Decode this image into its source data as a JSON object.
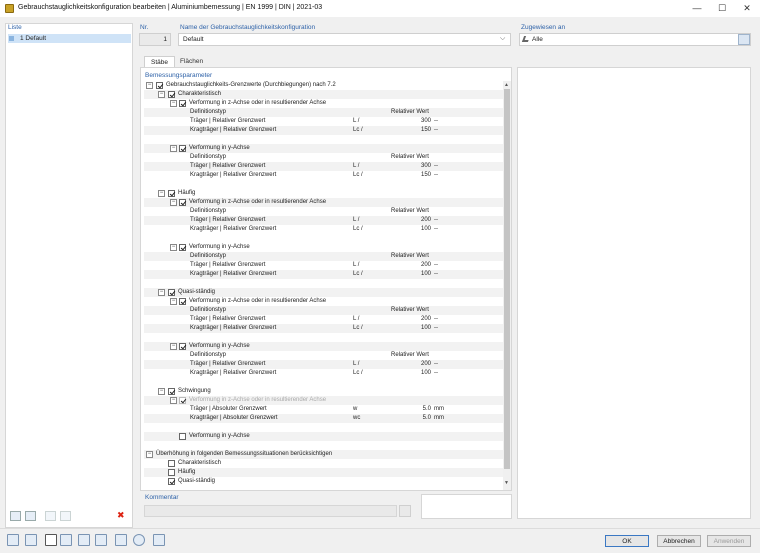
{
  "window": {
    "title": "Gebrauchstauglichkeitskonfiguration bearbeiten | Aluminiumbemessung | EN 1999 | DIN | 2021-03",
    "minimize": "—",
    "maximize": "☐",
    "close": "✕"
  },
  "left": {
    "header": "Liste",
    "item_label": "1  Default",
    "delete_icon": "✖"
  },
  "nr": {
    "header": "Nr.",
    "value": "1"
  },
  "name": {
    "header": "Name der Gebrauchstauglichkeitskonfiguration",
    "value": "Default",
    "chevron": "⌵"
  },
  "assigned": {
    "header": "Zugewiesen an",
    "value": "Alle"
  },
  "tabs": [
    {
      "label": "Stäbe"
    },
    {
      "label": "Flächen"
    }
  ],
  "params_header": "Bemessungsparameter",
  "tree": {
    "root": "Gebrauchstauglichkeits-Grenzwerte (Durchbiegungen) nach 7.2",
    "groups": [
      {
        "label": "Charakteristisch",
        "subs": [
          {
            "label": "Verformung in z-Achse oder in resultierender Achse",
            "deftype": "Definitionstyp",
            "deftype_value": "Relativer Wert",
            "r1": "Träger | Relativer Grenzwert",
            "r1_sym": "L /",
            "r1_val": "300",
            "r1_unit": "--",
            "r2": "Kragträger | Relativer Grenzwert",
            "r2_sym": "Lc /",
            "r2_val": "150",
            "r2_unit": "--"
          },
          {
            "label": "Verformung in y-Achse",
            "deftype": "Definitionstyp",
            "deftype_value": "Relativer Wert",
            "r1": "Träger | Relativer Grenzwert",
            "r1_sym": "L /",
            "r1_val": "300",
            "r1_unit": "--",
            "r2": "Kragträger | Relativer Grenzwert",
            "r2_sym": "Lc /",
            "r2_val": "150",
            "r2_unit": "--"
          }
        ]
      },
      {
        "label": "Häufig",
        "subs": [
          {
            "label": "Verformung in z-Achse oder in resultierender Achse",
            "deftype": "Definitionstyp",
            "deftype_value": "Relativer Wert",
            "r1": "Träger | Relativer Grenzwert",
            "r1_sym": "L /",
            "r1_val": "200",
            "r1_unit": "--",
            "r2": "Kragträger | Relativer Grenzwert",
            "r2_sym": "Lc /",
            "r2_val": "100",
            "r2_unit": "--"
          },
          {
            "label": "Verformung in y-Achse",
            "deftype": "Definitionstyp",
            "deftype_value": "Relativer Wert",
            "r1": "Träger | Relativer Grenzwert",
            "r1_sym": "L /",
            "r1_val": "200",
            "r1_unit": "--",
            "r2": "Kragträger | Relativer Grenzwert",
            "r2_sym": "Lc /",
            "r2_val": "100",
            "r2_unit": "--"
          }
        ]
      },
      {
        "label": "Quasi-ständig",
        "subs": [
          {
            "label": "Verformung in z-Achse oder in resultierender Achse",
            "deftype": "Definitionstyp",
            "deftype_value": "Relativer Wert",
            "r1": "Träger | Relativer Grenzwert",
            "r1_sym": "L /",
            "r1_val": "200",
            "r1_unit": "--",
            "r2": "Kragträger | Relativer Grenzwert",
            "r2_sym": "Lc /",
            "r2_val": "100",
            "r2_unit": "--"
          },
          {
            "label": "Verformung in y-Achse",
            "deftype": "Definitionstyp",
            "deftype_value": "Relativer Wert",
            "r1": "Träger | Relativer Grenzwert",
            "r1_sym": "L /",
            "r1_val": "200",
            "r1_unit": "--",
            "r2": "Kragträger | Relativer Grenzwert",
            "r2_sym": "Lc /",
            "r2_val": "100",
            "r2_unit": "--"
          }
        ]
      }
    ],
    "schwingung": {
      "label": "Schwingung",
      "sub_z": "Verformung in z-Achse oder in resultierender Achse",
      "r1": "Träger | Absoluter Grenzwert",
      "r1_sym": "w",
      "r1_val": "5.0",
      "r1_unit": "mm",
      "r2": "Kragträger | Absoluter Grenzwert",
      "r2_sym": "wc",
      "r2_val": "5.0",
      "r2_unit": "mm",
      "sub_y": "Verformung in y-Achse"
    },
    "ueberhoehung": {
      "label": "Überhöhung in folgenden Bemessungssituationen berücksichtigen",
      "items": [
        "Charakteristisch",
        "Häufig",
        "Quasi-ständig"
      ],
      "checked": [
        false,
        false,
        true
      ]
    }
  },
  "comment": {
    "header": "Kommentar"
  },
  "buttons": {
    "ok": "OK",
    "cancel": "Abbrechen",
    "apply": "Anwenden"
  },
  "colors": {
    "header_blue": "#2e62a8",
    "selection": "#cfe3f7"
  }
}
